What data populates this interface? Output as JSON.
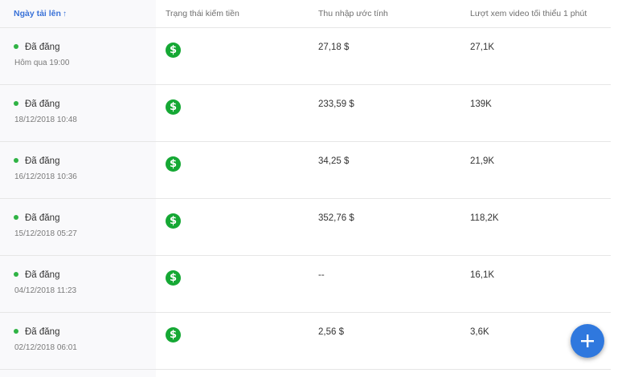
{
  "header": {
    "upload_date": "Ngày tải lên",
    "sort_arrow": "↑",
    "monetization_status": "Trạng thái kiếm tiền",
    "estimated_revenue": "Thu nhập ước tính",
    "min_views": "Lượt xem video tối thiểu 1 phút"
  },
  "rows": [
    {
      "status": "Đã đăng",
      "date": "Hôm qua 19:00",
      "revenue": "27,18 $",
      "views": "27,1K"
    },
    {
      "status": "Đã đăng",
      "date": "18/12/2018 10:48",
      "revenue": "233,59 $",
      "views": "139K"
    },
    {
      "status": "Đã đăng",
      "date": "16/12/2018 10:36",
      "revenue": "34,25 $",
      "views": "21,9K"
    },
    {
      "status": "Đã đăng",
      "date": "15/12/2018 05:27",
      "revenue": "352,76 $",
      "views": "118,2K"
    },
    {
      "status": "Đã đăng",
      "date": "04/12/2018 11:23",
      "revenue": "--",
      "views": "16,1K"
    },
    {
      "status": "Đã đăng",
      "date": "02/12/2018 06:01",
      "revenue": "2,56 $",
      "views": "3,6K"
    }
  ],
  "icons": {
    "monetization": "dollar-icon",
    "fab": "plus-icon"
  },
  "colors": {
    "accent": "#3a72d8",
    "status_dot": "#2fb344",
    "money_icon": "#15a834",
    "fab": "#2f78de"
  }
}
